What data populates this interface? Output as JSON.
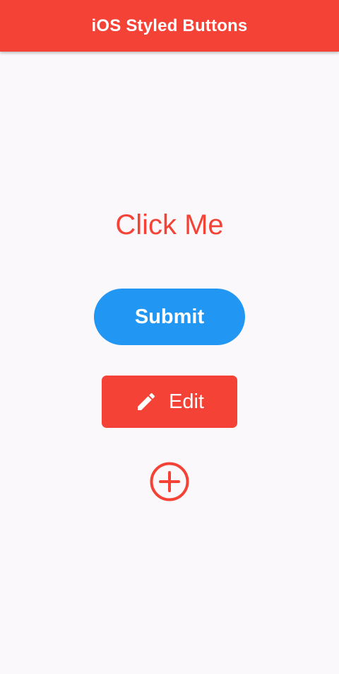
{
  "app_bar": {
    "title": "iOS Styled Buttons",
    "color": "#f44336"
  },
  "buttons": {
    "text_button_label": "Click Me",
    "submit_label": "Submit",
    "submit_color": "#2196f3",
    "edit_label": "Edit",
    "edit_icon": "pencil-icon",
    "edit_color": "#f44336",
    "add_icon": "add-circle-outline-icon",
    "add_color": "#f44336"
  }
}
